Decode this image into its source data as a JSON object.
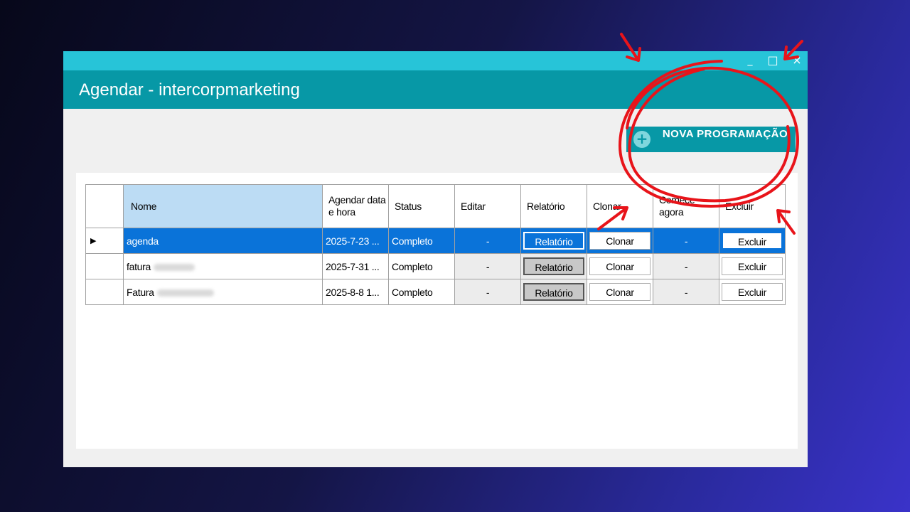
{
  "window": {
    "title": "Agendar - intercorpmarketing",
    "minimize_glyph": "_",
    "maximize_glyph": "□",
    "close_glyph": "×"
  },
  "toolbar": {
    "new_schedule_icon": "plus-circle-icon",
    "new_schedule_label": "NOVA PROGRAMAÇÃO"
  },
  "grid": {
    "columns": [
      "Nome",
      "Agendar data e hora",
      "Status",
      "Editar",
      "Relatório",
      "Clonar",
      "Comece agora",
      "Excluir"
    ],
    "rows": [
      {
        "indicator": "▶",
        "name": "agenda",
        "datetime": "2025-7-23 ...",
        "status": "Completo",
        "edit": "-",
        "report": "Relatório",
        "clone": "Clonar",
        "start_now": "-",
        "delete": "Excluir"
      },
      {
        "indicator": "",
        "name": "fatura",
        "datetime": "2025-7-31 ...",
        "status": "Completo",
        "edit": "-",
        "report": "Relatório",
        "clone": "Clonar",
        "start_now": "-",
        "delete": "Excluir"
      },
      {
        "indicator": "",
        "name": "Fatura",
        "datetime": "2025-8-8 1...",
        "status": "Completo",
        "edit": "-",
        "report": "Relatório",
        "clone": "Clonar",
        "start_now": "-",
        "delete": "Excluir"
      }
    ]
  },
  "colors": {
    "title_bar": "#27c4d8",
    "header": "#0798a6",
    "selection": "#0a73d9",
    "annotation": "#e8141a"
  }
}
